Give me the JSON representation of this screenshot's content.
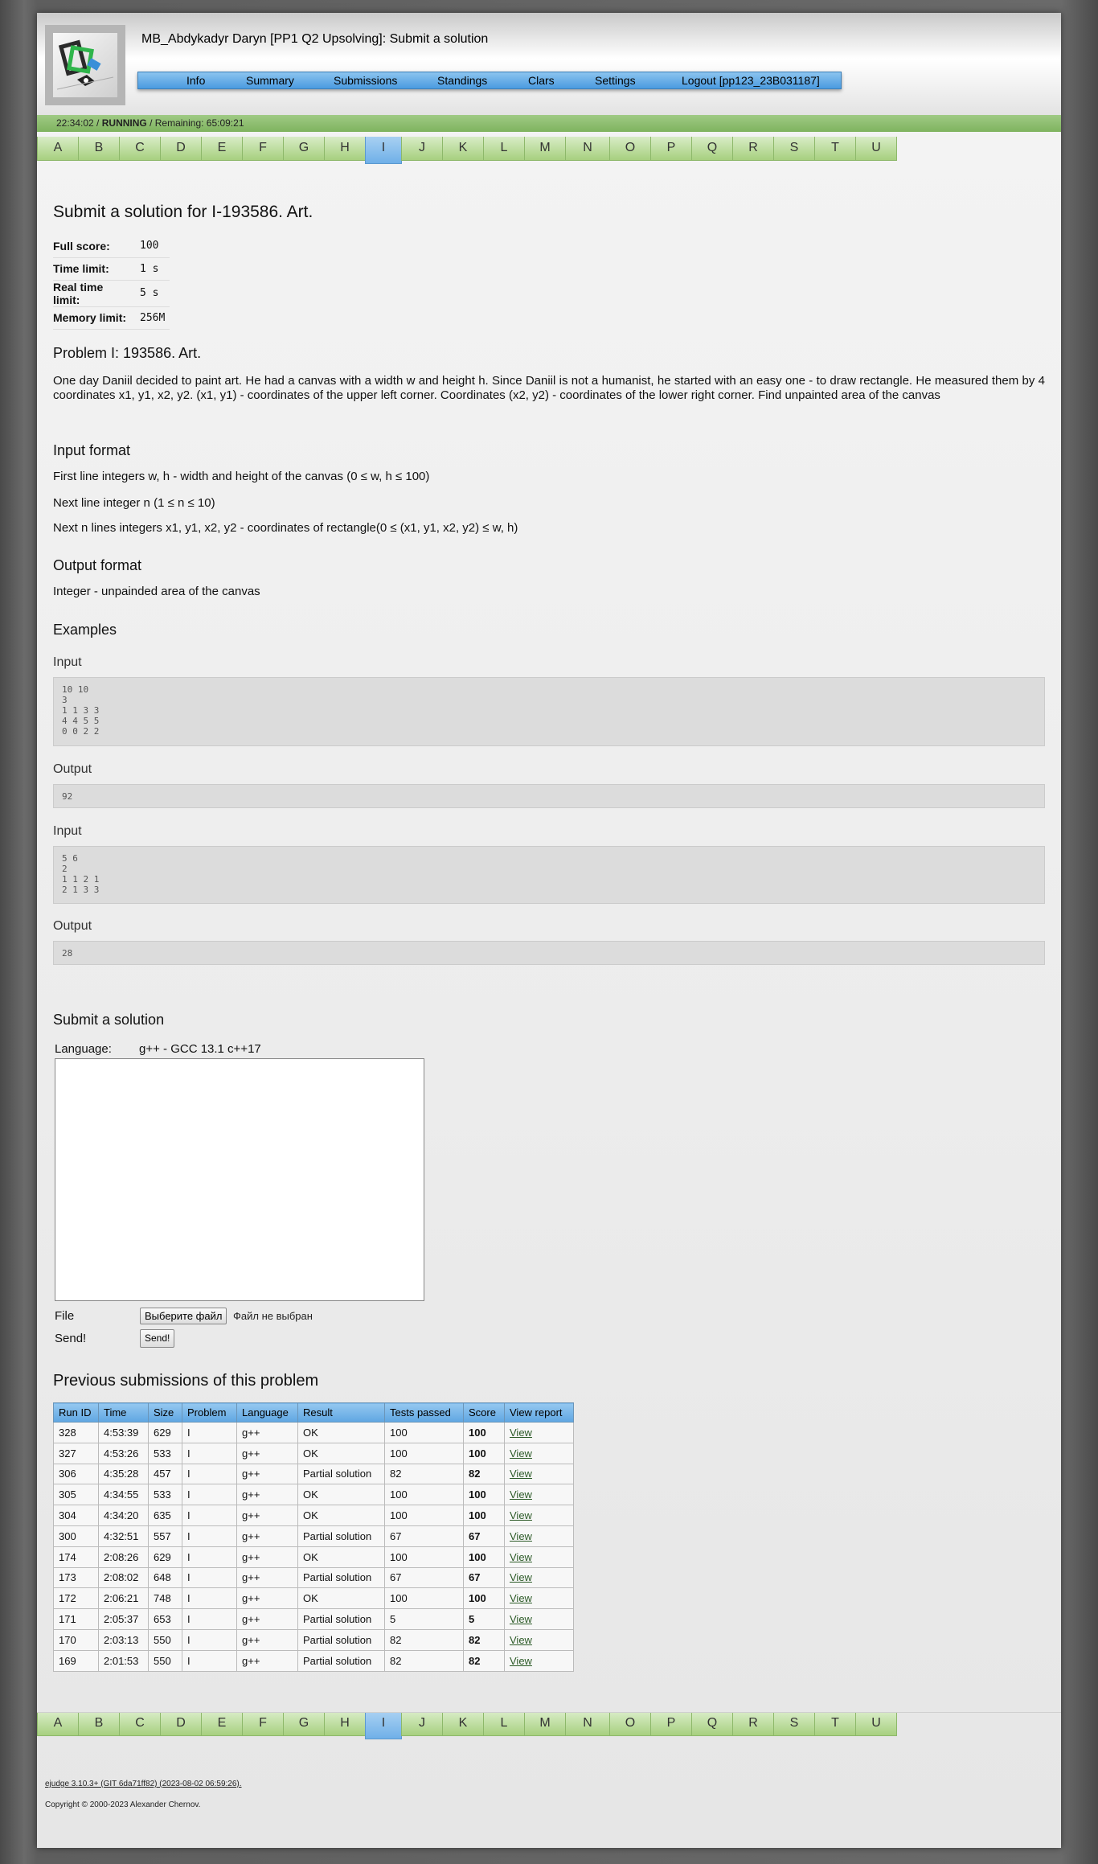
{
  "header": {
    "title": "MB_Abdykadyr Daryn [PP1 Q2 Upsolving]: Submit a solution",
    "menu": [
      "Info",
      "Summary",
      "Submissions",
      "Standings",
      "Clars",
      "Settings",
      "Logout [pp123_23B031187]"
    ]
  },
  "status": {
    "time": "22:34:02",
    "state": "RUNNING",
    "remaining": "Remaining: 65:09:21"
  },
  "problem_tabs": [
    "A",
    "B",
    "C",
    "D",
    "E",
    "F",
    "G",
    "H",
    "I",
    "J",
    "K",
    "L",
    "M",
    "N",
    "O",
    "P",
    "Q",
    "R",
    "S",
    "T",
    "U"
  ],
  "active_tab": "I",
  "problem": {
    "heading": "Submit a solution for I-193586. Art.",
    "limits": [
      {
        "label": "Full score:",
        "value": "100"
      },
      {
        "label": "Time limit:",
        "value": "1 s"
      },
      {
        "label": "Real time limit:",
        "value": "5 s"
      },
      {
        "label": "Memory limit:",
        "value": "256M"
      }
    ],
    "name_heading": "Problem I: 193586. Art.",
    "statement": "One day Daniil decided to paint art. He had a canvas with a width w and height h. Since Daniil is not a humanist, he started with an easy one - to draw rectangle. He measured them by 4 coordinates x1, y1, x2, y2. (x1, y1) - coordinates of the upper left corner. Coordinates (x2, y2) - coordinates of the lower right corner. Find unpainted area of the canvas",
    "input_heading": "Input format",
    "input_lines": [
      "First line integers w, h - width and height of the canvas (0 ≤ w, h ≤ 100)",
      "Next line integer n (1 ≤ n ≤ 10)",
      "Next n lines integers x1, y1, x2, y2 - coordinates of rectangle(0 ≤ (x1, y1, x2, y2) ≤ w, h)"
    ],
    "output_heading": "Output format",
    "output_text": "Integer - unpainded area of the canvas",
    "examples_heading": "Examples",
    "examples": [
      {
        "input_label": "Input",
        "input": "10 10\n3\n1 1 3 3\n4 4 5 5\n0 0 2 2",
        "output_label": "Output",
        "output": "92"
      },
      {
        "input_label": "Input",
        "input": "5 6\n2\n1 1 2 1\n2 1 3 3",
        "output_label": "Output",
        "output": "28"
      }
    ]
  },
  "submit": {
    "heading": "Submit a solution",
    "language_label": "Language:",
    "language_value": "g++ - GCC 13.1 c++17",
    "file_label": "File",
    "file_button": "Выберите файл",
    "file_status": "Файл не выбран",
    "send_label": "Send!",
    "send_button": "Send!"
  },
  "previous": {
    "heading": "Previous submissions of this problem",
    "columns": [
      "Run ID",
      "Time",
      "Size",
      "Problem",
      "Language",
      "Result",
      "Tests passed",
      "Score",
      "View report"
    ],
    "rows": [
      [
        "328",
        "4:53:39",
        "629",
        "I",
        "g++",
        "OK",
        "100",
        "100",
        "View"
      ],
      [
        "327",
        "4:53:26",
        "533",
        "I",
        "g++",
        "OK",
        "100",
        "100",
        "View"
      ],
      [
        "306",
        "4:35:28",
        "457",
        "I",
        "g++",
        "Partial solution",
        "82",
        "82",
        "View"
      ],
      [
        "305",
        "4:34:55",
        "533",
        "I",
        "g++",
        "OK",
        "100",
        "100",
        "View"
      ],
      [
        "304",
        "4:34:20",
        "635",
        "I",
        "g++",
        "OK",
        "100",
        "100",
        "View"
      ],
      [
        "300",
        "4:32:51",
        "557",
        "I",
        "g++",
        "Partial solution",
        "67",
        "67",
        "View"
      ],
      [
        "174",
        "2:08:26",
        "629",
        "I",
        "g++",
        "OK",
        "100",
        "100",
        "View"
      ],
      [
        "173",
        "2:08:02",
        "648",
        "I",
        "g++",
        "Partial solution",
        "67",
        "67",
        "View"
      ],
      [
        "172",
        "2:06:21",
        "748",
        "I",
        "g++",
        "OK",
        "100",
        "100",
        "View"
      ],
      [
        "171",
        "2:05:37",
        "653",
        "I",
        "g++",
        "Partial solution",
        "5",
        "5",
        "View"
      ],
      [
        "170",
        "2:03:13",
        "550",
        "I",
        "g++",
        "Partial solution",
        "82",
        "82",
        "View"
      ],
      [
        "169",
        "2:01:53",
        "550",
        "I",
        "g++",
        "Partial solution",
        "82",
        "82",
        "View"
      ]
    ]
  },
  "footer": {
    "version": "ejudge 3.10.3+ (GIT 6da71ff82) (2023-08-02 06:59:26).",
    "copyright": "Copyright © 2000-2023 Alexander Chernov."
  },
  "colors": {
    "menu_blue": "#5fa6e2",
    "tab_green": "#a7d07f",
    "tab_active": "#6fb0e8",
    "status_green": "#7fb35f",
    "link": "#2d5b28"
  }
}
